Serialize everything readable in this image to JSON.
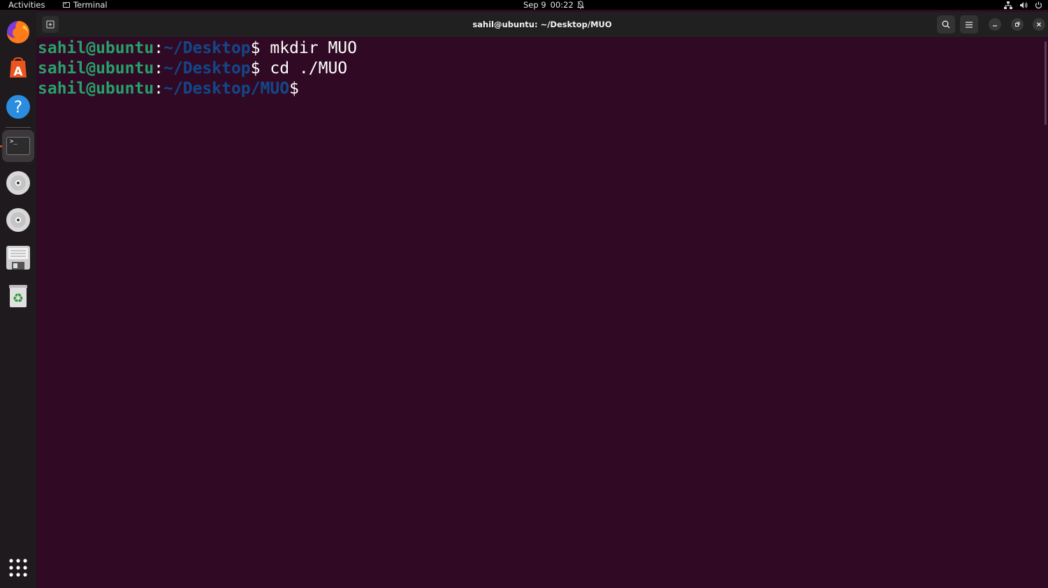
{
  "topbar": {
    "activities": "Activities",
    "app_name": "Terminal",
    "date": "Sep 9",
    "time": "00:22"
  },
  "dock": {
    "items": [
      {
        "name": "firefox",
        "icon": "firefox-icon"
      },
      {
        "name": "app-center",
        "icon": "app-store-icon"
      },
      {
        "name": "help",
        "icon": "help-icon",
        "glyph": "?"
      },
      {
        "name": "terminal",
        "icon": "terminal-icon",
        "glyph": ">_",
        "active": true
      },
      {
        "name": "disc-1",
        "icon": "disc-icon"
      },
      {
        "name": "disc-2",
        "icon": "disc-icon"
      },
      {
        "name": "floppy",
        "icon": "floppy-icon"
      },
      {
        "name": "trash",
        "icon": "trash-icon",
        "glyph": "♻"
      },
      {
        "name": "show-apps",
        "icon": "app-grid-icon"
      }
    ]
  },
  "window": {
    "title": "sahil@ubuntu: ~/Desktop/MUO"
  },
  "terminal": {
    "lines": [
      {
        "user": "sahil@ubuntu",
        "sep": ":",
        "path": "~/Desktop",
        "prompt": "$",
        "command": " mkdir MUO"
      },
      {
        "user": "sahil@ubuntu",
        "sep": ":",
        "path": "~/Desktop",
        "prompt": "$",
        "command": " cd ./MUO"
      },
      {
        "user": "sahil@ubuntu",
        "sep": ":",
        "path": "~/Desktop/MUO",
        "prompt": "$",
        "command": ""
      }
    ]
  },
  "colors": {
    "terminal_bg": "#300a24",
    "user_host": "#26a269",
    "path": "#12488b",
    "text": "#ffffff",
    "accent": "#e95420"
  }
}
